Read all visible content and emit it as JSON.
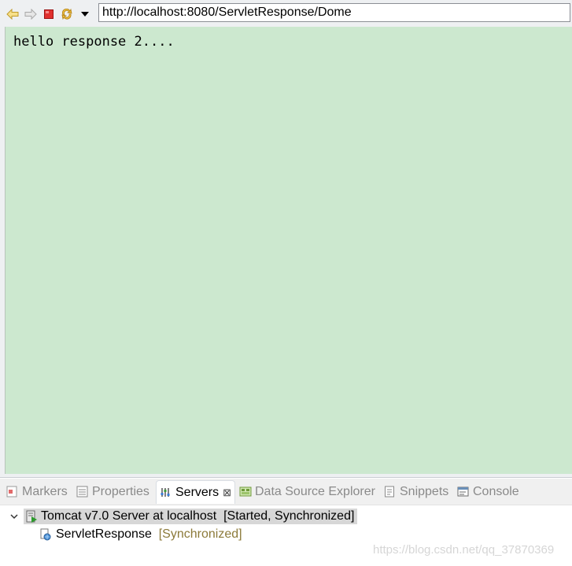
{
  "browser": {
    "url": "http://localhost:8080/ServletResponse/Dome",
    "content_text": "hello response 2...."
  },
  "panel": {
    "tabs": [
      {
        "label": "Markers",
        "icon": "markers-icon"
      },
      {
        "label": "Properties",
        "icon": "properties-icon"
      },
      {
        "label": "Servers",
        "icon": "servers-icon",
        "active": true
      },
      {
        "label": "Data Source Explorer",
        "icon": "data-source-icon"
      },
      {
        "label": "Snippets",
        "icon": "snippets-icon"
      },
      {
        "label": "Console",
        "icon": "console-icon"
      }
    ],
    "close_glyph": "⊠",
    "server": {
      "name": "Tomcat v7.0 Server at localhost",
      "status": "[Started, Synchronized]"
    },
    "module": {
      "name": "ServletResponse",
      "status": "[Synchronized]"
    }
  },
  "watermark": "https://blog.csdn.net/qq_37870369",
  "colors": {
    "content_bg": "#cce8cf",
    "selected_row_bg": "#d7d7d7",
    "sync_status": "#8c7a3a"
  }
}
